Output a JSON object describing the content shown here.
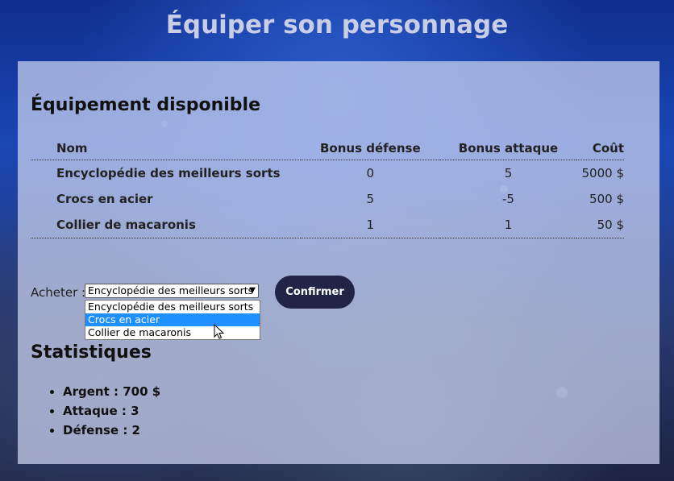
{
  "page_title": "Équiper son personnage",
  "equipment": {
    "heading": "Équipement disponible",
    "columns": [
      "Nom",
      "Bonus défense",
      "Bonus attaque",
      "Coût"
    ],
    "rows": [
      [
        "Encyclopédie des meilleurs sorts",
        "0",
        "5",
        "5000 $"
      ],
      [
        "Crocs en acier",
        "5",
        "-5",
        "500 $"
      ],
      [
        "Collier de macaronis",
        "1",
        "1",
        "50 $"
      ]
    ]
  },
  "purchase": {
    "label": "Acheter :",
    "selected": "Encyclopédie des meilleurs sorts",
    "options": [
      "Encyclopédie des meilleurs sorts",
      "Crocs en acier",
      "Collier de macaronis"
    ],
    "highlighted_option": "Crocs en acier",
    "confirm_label": "Confirmer"
  },
  "stats": {
    "heading": "Statistiques",
    "items": [
      "Argent : 700 $",
      "Attaque : 3",
      "Défense : 2"
    ]
  },
  "colors": {
    "button_bg": "#222447",
    "highlight": "#1e90ff"
  }
}
